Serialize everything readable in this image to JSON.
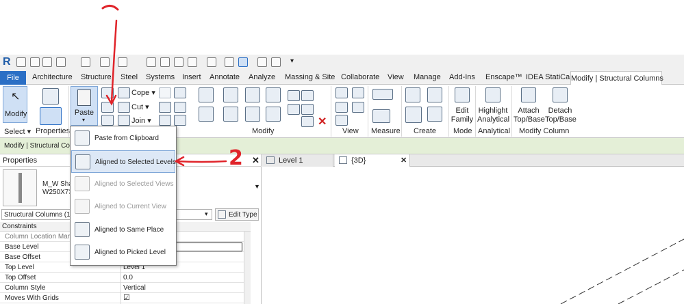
{
  "quick_access": {
    "logo": "R"
  },
  "tabs": {
    "file": "File",
    "items": [
      "Architecture",
      "Structure",
      "Steel",
      "Systems",
      "Insert",
      "Annotate",
      "Analyze",
      "Massing & Site",
      "Collaborate",
      "View",
      "Manage",
      "Add-Ins",
      "Enscape™",
      "IDEA StatiCa"
    ],
    "active": "Modify | Structural Columns"
  },
  "ribbon": {
    "modify_label": "Modify",
    "select_label": "Select ▾",
    "properties_label": "Properties",
    "paste_label": "Paste",
    "cope_label": "Cope ▾",
    "cut_label": "Cut ▾",
    "join_label": "Join ▾",
    "panel_modify": "Modify",
    "panel_view": "View",
    "panel_measure": "Measure",
    "panel_create": "Create",
    "edit_family": "Edit\nFamily",
    "highlight_analytical": "Highlight\nAnalytical",
    "attach_top_base": "Attach\nTop/Base",
    "detach_top_base": "Detach\nTop/Base",
    "panel_mode": "Mode",
    "panel_analytical": "Analytical",
    "panel_modify_column": "Modify Column"
  },
  "options_bar": {
    "context": "Modify | Structural Co"
  },
  "properties": {
    "title": "Properties",
    "type_name_1": "M_W Sha",
    "type_name_2": "W250X73",
    "selector": "Structural Columns (1)",
    "edit_type": "Edit Type",
    "section": "Constraints",
    "rows": [
      {
        "name": "Column Location Mar",
        "value": ""
      },
      {
        "name": "Base Level",
        "value": ""
      },
      {
        "name": "Base Offset",
        "value": ""
      },
      {
        "name": "Top Level",
        "value": "Level 1"
      },
      {
        "name": "Top Offset",
        "value": "0.0"
      },
      {
        "name": "Column Style",
        "value": "Vertical"
      },
      {
        "name": "Moves With Grids",
        "value": "☑"
      }
    ]
  },
  "view_tabs": [
    {
      "label": "Level 1"
    },
    {
      "label": "{3D}"
    }
  ],
  "paste_menu": {
    "items": [
      {
        "label": "Paste from Clipboard",
        "enabled": true
      },
      {
        "label": "Aligned to Selected Levels",
        "enabled": true
      },
      {
        "label": "Aligned to Selected Views",
        "enabled": false
      },
      {
        "label": "Aligned to Current View",
        "enabled": false
      },
      {
        "label": "Aligned to Same Place",
        "enabled": true
      },
      {
        "label": "Aligned to Picked Level",
        "enabled": true
      }
    ]
  },
  "annotations": {
    "step2": "2"
  },
  "colors": {
    "file_tab": "#2b6fc5",
    "options_bar": "#e4efd7",
    "annotation": "#e0242a"
  }
}
